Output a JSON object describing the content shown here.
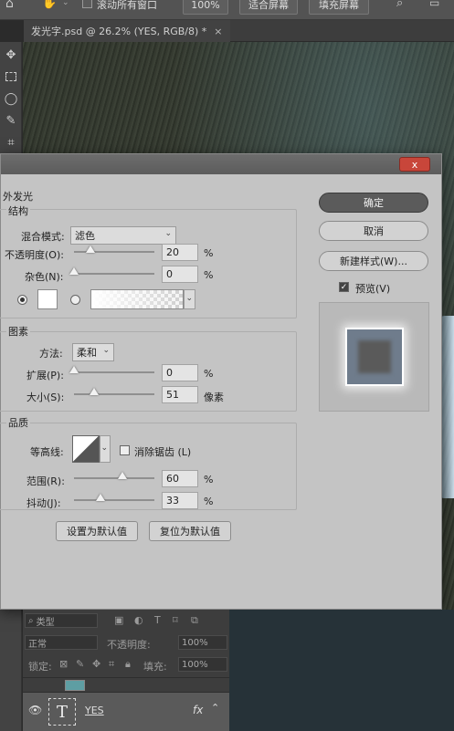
{
  "options_bar": {
    "scroll_all_label": "滚动所有窗口",
    "zoom_btn": "100%",
    "fit_btn": "适合屏幕",
    "fill_btn": "填充屏幕"
  },
  "document_tab": {
    "title": "发光字.psd @ 26.2% (YES, RGB/8) *",
    "close": "×"
  },
  "dialog": {
    "close_glyph": "x",
    "section_title": "外发光",
    "structure": {
      "header": "结构",
      "blend_mode_label": "混合模式:",
      "blend_mode_value": "滤色",
      "opacity_label": "不透明度(O):",
      "opacity_value": "20",
      "noise_label": "杂色(N):",
      "noise_value": "0",
      "percent": "%"
    },
    "elements": {
      "header": "图素",
      "method_label": "方法:",
      "method_value": "柔和",
      "spread_label": "扩展(P):",
      "spread_value": "0",
      "size_label": "大小(S):",
      "size_value": "51",
      "size_unit": "像素",
      "percent": "%"
    },
    "quality": {
      "header": "品质",
      "contour_label": "等高线:",
      "antialias_label": "消除锯齿 (L)",
      "range_label": "范围(R):",
      "range_value": "60",
      "jitter_label": "抖动(J):",
      "jitter_value": "33",
      "percent": "%"
    },
    "buttons": {
      "set_default": "设置为默认值",
      "reset_default": "复位为默认值",
      "ok": "确定",
      "cancel": "取消",
      "new_style": "新建样式(W)...",
      "preview_label": "预览(V)"
    },
    "slider_levels": {
      "opacity": 0.2,
      "noise": 0.0,
      "spread": 0.0,
      "size": 0.25,
      "range": 0.6,
      "jitter": 0.33
    }
  },
  "layers_panel": {
    "filter_kind": "类型",
    "blend_mode": "正常",
    "opacity_label": "不透明度:",
    "opacity_value": "100%",
    "lock_label": "锁定:",
    "fill_label": "填充:",
    "fill_value": "100%",
    "layer_text_name": "YES",
    "fx": "fx"
  }
}
